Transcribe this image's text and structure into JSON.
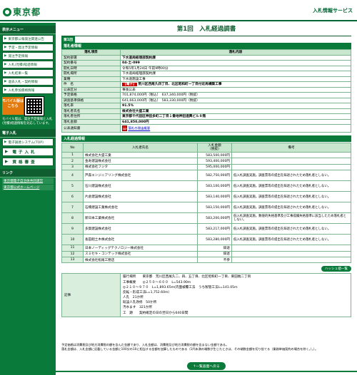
{
  "header": {
    "logo_text": "東京都",
    "service_name": "入札情報サービス"
  },
  "sidebar": {
    "section1": "表示メニュー",
    "items": [
      {
        "label": "東京都公報発注関連公告"
      },
      {
        "label": "予定・発注予定情報"
      },
      {
        "label": "発注予定情報"
      },
      {
        "label": "入札(見積)経過情報"
      },
      {
        "label": "入札結果一覧"
      },
      {
        "label": "過去入札・契約情報"
      },
      {
        "label": "入札参加資格情報"
      }
    ],
    "mobile_badge": "モバイル版はこちら",
    "mobile_note": "モバイル版は、発注予定情報と入札(見積)経過情報を対応しています。",
    "section2": "電子入札",
    "system_link": "電子調達システム(TOP)",
    "big1": "電子入札",
    "big2": "資格審査",
    "section3": "リンク",
    "links": [
      "東京都電子自治体共同運営",
      "東京都公式ホームページ"
    ]
  },
  "page": {
    "title": "第1回　入札経過調書",
    "tab": "第1回"
  },
  "contract": {
    "section_title": "落札者情報",
    "col_item": "落札項目",
    "col_content": "落札内容",
    "rows": [
      {
        "label": "契約部署",
        "value": "下水道局経理部契約課",
        "bold": true
      },
      {
        "label": "契約番号",
        "value": "04-土-099",
        "bold": true
      },
      {
        "label": "開札日時",
        "value": "令和5年1月24日 午前9時00分",
        "bold": false
      },
      {
        "label": "開札場所",
        "value": "下水道局経理部契約課",
        "bold": false
      },
      {
        "label": "業種",
        "value": "下水道施設工事",
        "bold": false
      }
    ],
    "name_label": "件　名",
    "name_tag": "【電子】",
    "name_value": "荒川区西尾久四丁目、北区昭和町一丁目付近再構築工事",
    "rows2": [
      {
        "label": "公表区分",
        "value": "事後公表",
        "bold": false
      },
      {
        "label": "予定価格",
        "value": "701,874,000円（税込）　637,340,000円（税抜）",
        "bold": false
      },
      {
        "label": "調査基準価格",
        "value": "641,663,000円（税込）　583,330,000円（税抜）",
        "bold": false
      },
      {
        "label": "落札率",
        "value": "91.5%",
        "bold": true
      },
      {
        "label": "落札者氏名",
        "value": "株式会社大盛工業",
        "bold": true
      },
      {
        "label": "落札者住所",
        "value": "東京都千代田区神田多町二丁目１番地神田進興ビル８階",
        "bold": true
      },
      {
        "label": "落札金額",
        "value": "641,850,000円",
        "bold": true
      }
    ],
    "notice_label": "公表通知書",
    "notice_link": "落札の理由概要",
    "pdf_icon": "PDF"
  },
  "bids": {
    "section_title": "入札経過情報",
    "col_no": "No",
    "col_name": "入札者氏名",
    "col_amount_1": "入札金額",
    "col_amount_2": "（税抜）",
    "col_note": "備考",
    "rows": [
      {
        "no": "1",
        "name": "株式会社大盛工業",
        "amount": "583,500,000円",
        "note": ""
      },
      {
        "no": "2",
        "name": "金寿建設株式会社",
        "amount": "593,400,000円",
        "note": ""
      },
      {
        "no": "3",
        "name": "株式会社フジタ",
        "amount": "595,000,000円",
        "note": ""
      },
      {
        "no": "4",
        "name": "芦森エンジニアリング株式会社",
        "amount": "582,750,000円",
        "note": "低入札調査実施。調査票等の提出を辞退されたため落札者としない。"
      },
      {
        "no": "5",
        "name": "石川建設株式会社",
        "amount": "583,100,000円",
        "note": "低入札調査実施。調査票等の提出を辞退されたため落札者としない。"
      },
      {
        "no": "6",
        "name": "片倉建設株式会社",
        "amount": "583,140,000円",
        "note": "低入札調査実施。調査票等の提出を辞退されたため落札者としない。"
      },
      {
        "no": "7",
        "name": "石橋建設工業株式会社",
        "amount": "583,150,000円",
        "note": "低入札調査実施。調査票等の提出を辞退されたため落札者としない。"
      },
      {
        "no": "8",
        "name": "新日本工業株式会社",
        "amount": "583,200,000円",
        "note": "低入札調査実施。数値的失格基準及び工事成績失格基準に該当したため落札者としない。"
      },
      {
        "no": "9",
        "name": "多賀建設株式会社",
        "amount": "583,217,000円",
        "note": "低入札調査実施。調査票等の提出を辞退されたため落札者としない。"
      },
      {
        "no": "10",
        "name": "長田組土木株式会社",
        "amount": "583,280,000円",
        "note": "低入札調査実施。調査票等の提出を辞退されたため落札者としない。"
      },
      {
        "no": "11",
        "name": "日本ノーディッグテクノロジー株式会社",
        "amount": "辞退",
        "note": ""
      },
      {
        "no": "12",
        "name": "スミセキ・コンテック株式会社",
        "amount": "辞退",
        "note": ""
      },
      {
        "no": "13",
        "name": "株式会社松尾工務店",
        "amount": "不参",
        "note": ""
      }
    ]
  },
  "history_button": "ハッシュ値一覧",
  "remarks": {
    "label": "記事",
    "lines": [
      "履行場所　　東京都　荒川区西尾久二、四、五丁目、北区昭和町一丁目、東田端二丁目",
      "工事概要　　◎２５０～６００　L=543.90m",
      "◎２１０～９７０　L=1,893.65m(内面被覆工法　うち製管工法L=141.05m",
      "反転・形成工法L=1,752.60m）",
      "人孔　21か所",
      "既設人孔改修　50か所",
      "汚水ます　321か所",
      "工　期　　契約確定の日の翌日から640日間"
    ]
  },
  "footnote": [
    "予定価格は消費税及び地方消費税の額を含んだ金額であり、入札金額は、消費税及び地方消費税の額を含まない金額である。",
    "落札金額は、入札金額に記載している金額に100分の10に相当する金額を加算したものである（1円未満の端数が生じたときは、その端数金額を切り捨てる（業務単価契約の場合を除く。）。）。"
  ],
  "back_button": "↑一覧画面へ戻る"
}
